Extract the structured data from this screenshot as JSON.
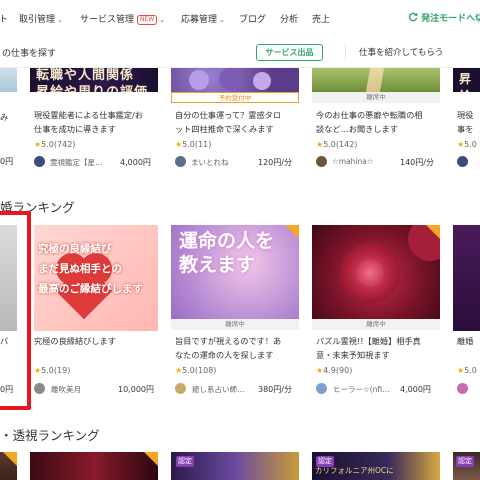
{
  "nav": {
    "items": [
      {
        "label": "ト",
        "chevron": false,
        "new": false
      },
      {
        "label": "取引管理",
        "chevron": true,
        "new": false
      },
      {
        "label": "サービス管理",
        "chevron": true,
        "new": true
      },
      {
        "label": "応募管理",
        "chevron": true,
        "new": false
      },
      {
        "label": "ブログ",
        "chevron": false,
        "new": false
      },
      {
        "label": "分析",
        "chevron": false,
        "new": false
      },
      {
        "label": "売上",
        "chevron": false,
        "new": false
      }
    ],
    "new_badge": "NEW",
    "switch_label": "発注モードへ切"
  },
  "subbar": {
    "text": "の仕事を探す",
    "service_button": "サービス出品",
    "intro_link": "仕事を紹介してもらう"
  },
  "row1": [
    {
      "thumb_text": "",
      "title": "み",
      "rating": "",
      "seller": "",
      "price": "0円"
    },
    {
      "thumb_text": "転職や人間関係\n昇給や周りの評価",
      "title": "現役霊能者による仕事鑑定/お\n仕事を成功に導きます",
      "rating": "5.0",
      "reviews": "(742)",
      "seller": "霊視鑑定【星…",
      "price": "4,000円"
    },
    {
      "thumb_text": "",
      "tag": "予約受付中",
      "title": "自分の仕事運って？霊感タロ\nット四柱推命で深くみます",
      "rating": "5.0",
      "reviews": "(11)",
      "seller": "まいとれね",
      "price": "120円/分"
    },
    {
      "thumb_text": "",
      "tag": "離席中",
      "title": "今のお仕事の悪癖や転職の相\n談など…お聞きします",
      "rating": "5.0",
      "reviews": "(142)",
      "seller": "☆mahina☆",
      "price": "140円/分"
    },
    {
      "thumb_text": "昇給",
      "title": "現役\n事を",
      "rating": "5.0",
      "reviews": "",
      "seller": "",
      "price": ""
    }
  ],
  "section2_title": "婚ランキング",
  "row2": [
    {
      "title": "バ",
      "price": "0円"
    },
    {
      "thumb_text": "究極の良縁結び\nまだ見ぬ相手との\n最高のご縁結びします",
      "title": "究極の良縁結びします",
      "rating": "5.0",
      "reviews": "(19)",
      "seller": "離吹美月",
      "price": "10,000円"
    },
    {
      "thumb_text": "運命の人を\n教えます",
      "tag": "離席中",
      "title": "旨目ですが視えるのです！あ\nなたの運命の人を探します",
      "rating": "5.0",
      "reviews": "(108)",
      "seller": "癒し系占い師…",
      "price": "380円/分"
    },
    {
      "thumb_text": "",
      "tag": "離席中",
      "title": "パズル霊視!!【離婚】相手真\n意・未来予知視ます",
      "rating": "4.9",
      "reviews": "(90)",
      "seller": "ヒーラー☆(nfi…",
      "price": "4,000円"
    },
    {
      "thumb_text": "",
      "title": "離婚",
      "rating": "5.0",
      "reviews": "",
      "seller": "",
      "price": ""
    }
  ],
  "section3_title": "・透視ランキング",
  "row3": [
    {
      "badge": ""
    },
    {
      "badge": ""
    },
    {
      "badge": "認定"
    },
    {
      "badge": "認定",
      "thumb_text": "カリフォルニア州OCに"
    },
    {
      "badge": "認定"
    }
  ]
}
